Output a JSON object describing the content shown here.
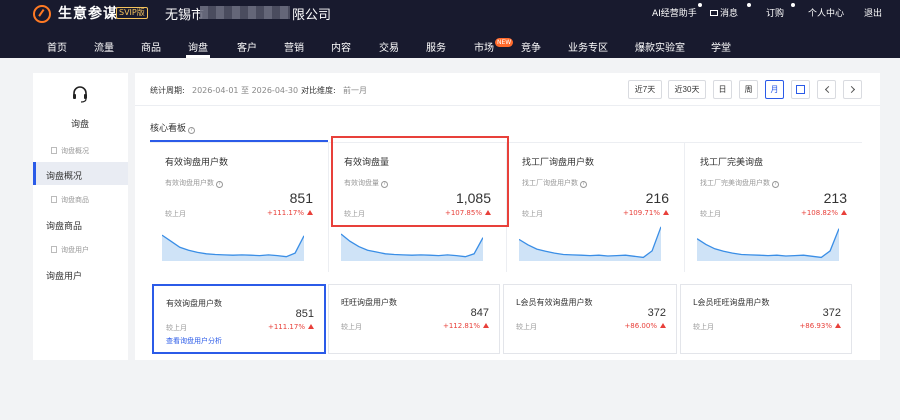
{
  "header": {
    "brand": "生意参谋",
    "edition": "SVIP版",
    "company_prefix": "无锡市",
    "company_suffix": "限公司",
    "right_links": [
      "AI经营助手",
      "消息",
      "订购",
      "个人中心",
      "退出"
    ]
  },
  "nav": {
    "items": [
      "首页",
      "流量",
      "商品",
      "询盘",
      "客户",
      "营销",
      "内容",
      "交易",
      "服务",
      "市场",
      "竞争",
      "业务专区",
      "爆款实验室",
      "学堂"
    ],
    "active": "询盘",
    "new_badge": "NEW"
  },
  "sidebar": {
    "title": "询盘",
    "groups": [
      {
        "sub": "询盘概况",
        "item": "询盘概况"
      },
      {
        "sub": "询盘商品",
        "item": "询盘商品"
      },
      {
        "sub": "询盘用户",
        "item": "询盘用户"
      }
    ],
    "active": "询盘概况"
  },
  "filter": {
    "period_label": "统计周期:",
    "period_value": "2026-04-01 至 2026-04-30",
    "compare_label": "对比维度:",
    "compare_value": "前一月",
    "buttons": [
      "近7天",
      "近30天",
      "日",
      "周",
      "月"
    ],
    "selected": "月"
  },
  "section": {
    "title": "核心看板"
  },
  "kpi_cards": [
    {
      "title": "有效询盘用户数",
      "sub": "有效询盘用户数",
      "value": "851",
      "compare": "较上月",
      "pct": "+111.17%",
      "trend": [
        0.72,
        0.55,
        0.38,
        0.3,
        0.24,
        0.2,
        0.18,
        0.17,
        0.16,
        0.17,
        0.16,
        0.15,
        0.17,
        0.15,
        0.12,
        0.22,
        0.7
      ]
    },
    {
      "title": "有效询盘量",
      "sub": "有效询盘量",
      "value": "1,085",
      "compare": "较上月",
      "pct": "+107.85%",
      "trend": [
        0.75,
        0.55,
        0.4,
        0.3,
        0.25,
        0.2,
        0.18,
        0.17,
        0.16,
        0.17,
        0.16,
        0.15,
        0.17,
        0.15,
        0.12,
        0.2,
        0.65
      ]
    },
    {
      "title": "找工厂询盘用户数",
      "sub": "找工厂询盘用户数",
      "value": "216",
      "compare": "较上月",
      "pct": "+109.71%",
      "trend": [
        0.6,
        0.45,
        0.33,
        0.27,
        0.22,
        0.18,
        0.17,
        0.16,
        0.15,
        0.16,
        0.14,
        0.15,
        0.16,
        0.13,
        0.1,
        0.28,
        0.95
      ]
    },
    {
      "title": "找工厂完美询盘",
      "sub": "找工厂完美询盘用户数",
      "value": "213",
      "compare": "较上月",
      "pct": "+108.82%",
      "trend": [
        0.62,
        0.46,
        0.34,
        0.27,
        0.22,
        0.18,
        0.17,
        0.16,
        0.15,
        0.16,
        0.14,
        0.15,
        0.16,
        0.13,
        0.1,
        0.28,
        0.9
      ]
    }
  ],
  "bottom_cards": [
    {
      "title": "有效询盘用户数",
      "value": "851",
      "compare": "较上月",
      "pct": "+111.17%",
      "link": "查看询盘用户分析"
    },
    {
      "title": "旺旺询盘用户数",
      "value": "847",
      "compare": "较上月",
      "pct": "+112.81%"
    },
    {
      "title": "L会员有效询盘用户数",
      "value": "372",
      "compare": "较上月",
      "pct": "+86.00%"
    },
    {
      "title": "L会员旺旺询盘用户数",
      "value": "372",
      "compare": "较上月",
      "pct": "+86.93%"
    }
  ]
}
